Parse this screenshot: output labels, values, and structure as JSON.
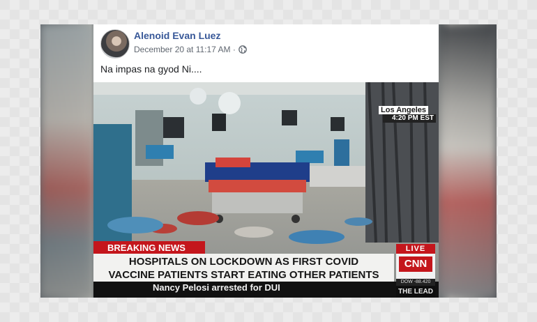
{
  "post": {
    "author": "Alenoid Evan Luez",
    "timestamp": "December 20 at 11:17 AM ·",
    "privacy_icon": "globe-icon",
    "caption": "Na impas na gyod Ni...."
  },
  "broadcast": {
    "location": "Los Angeles",
    "time": "4:20 PM EST",
    "breaking_label": "BREAKING NEWS",
    "headline_line1": "HOSPITALS ON LOCKDOWN AS FIRST COVID",
    "headline_line2": "VACCINE PATIENTS START EATING OTHER PATIENTS",
    "live_label": "LIVE",
    "network": "CNN",
    "ticker": "Nancy Pelosi arrested for DUI",
    "dow": "DOW   -88.420",
    "show_name": "THE LEAD"
  },
  "colors": {
    "author_link": "#385898",
    "cnn_red": "#c4161c"
  }
}
